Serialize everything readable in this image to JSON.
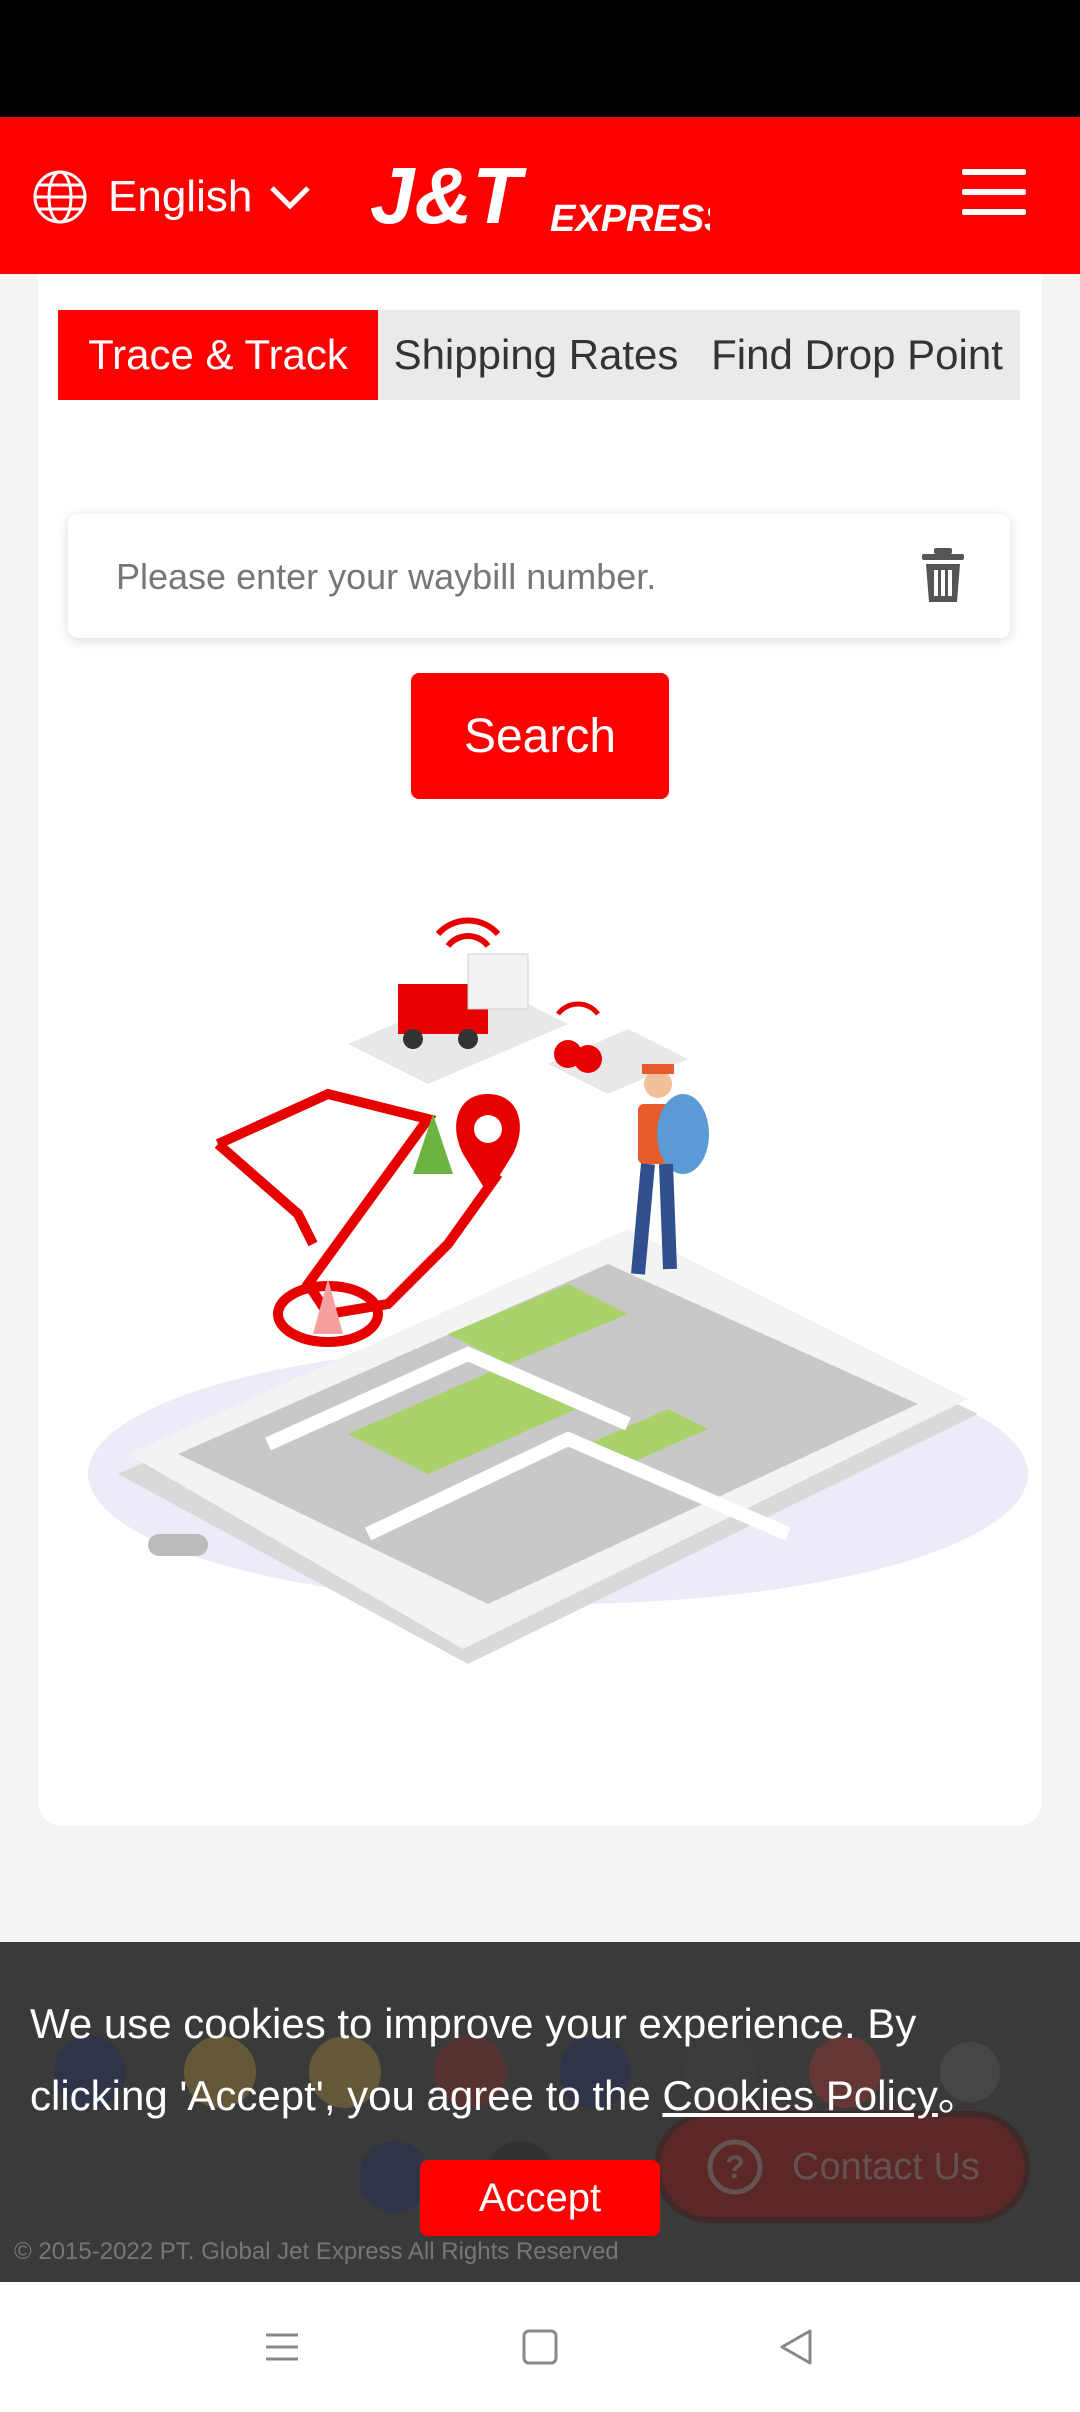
{
  "header": {
    "language_label": "English",
    "logo_text_main": "J&T",
    "logo_text_sub": "EXPRESS",
    "brand_color": "#ff0000"
  },
  "tabs": [
    {
      "label": "Trace & Track",
      "active": true
    },
    {
      "label": "Shipping Rates",
      "active": false
    },
    {
      "label": "Find Drop Point",
      "active": false
    }
  ],
  "search": {
    "placeholder": "Please enter your waybill number.",
    "value": "",
    "button_label": "Search"
  },
  "footer": {
    "copyright": "© 2015-2022 PT. Global Jet Express All Rights Reserved",
    "contact_label": "Contact Us"
  },
  "cookie": {
    "text": "We use cookies to improve your experience. By clicking 'Accept', you agree to the",
    "link_text": "Cookies Policy",
    "suffix": "。",
    "accept_label": "Accept"
  },
  "icons": {
    "language": "globe-icon",
    "dropdown": "chevron-down-icon",
    "menu": "hamburger-menu-icon",
    "clear": "trash-icon",
    "contact": "question-icon",
    "nav": [
      "recent-apps-icon",
      "home-icon",
      "back-icon"
    ]
  }
}
